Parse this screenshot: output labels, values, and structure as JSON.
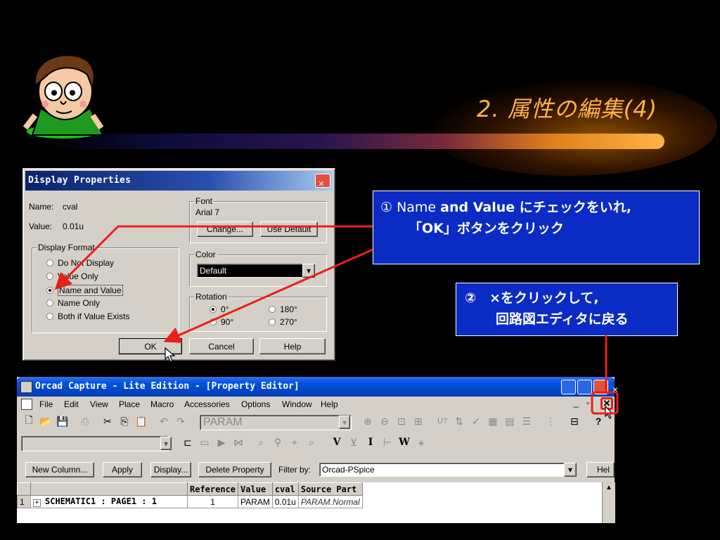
{
  "slide": {
    "title": "2. 属性の編集(4)"
  },
  "callouts": {
    "step1_line1_prefix": "① Name ",
    "step1_line1_bold": "and Value",
    "step1_line1_suffix": " にチェックをいれ,",
    "step1_line2": "「OK」ボタンをクリック",
    "step2_line1": "②　×をクリックして,",
    "step2_line2": "回路図エディタに戻る"
  },
  "dialog": {
    "title": "Display Properties",
    "name_label": "Name:",
    "name_value": "cval",
    "value_label": "Value:",
    "value_value": "0.01u",
    "format_legend": "Display Format",
    "format_options": [
      "Do Not Display",
      "Value Only",
      "Name and Value",
      "Name Only",
      "Both if Value Exists"
    ],
    "format_selected": "Name and Value",
    "font_legend": "Font",
    "font_value": "Arial 7",
    "change_button": "Change...",
    "use_default_button": "Use Default",
    "color_legend": "Color",
    "color_value": "Default",
    "rotation_legend": "Rotation",
    "rotation_options": [
      "0°",
      "90°",
      "180°",
      "270°"
    ],
    "rotation_selected": "0°",
    "ok_button": "OK",
    "cancel_button": "Cancel",
    "help_button": "Help"
  },
  "orcad": {
    "title": "Orcad Capture - Lite Edition - [Property Editor]",
    "menus": [
      "File",
      "Edit",
      "View",
      "Place",
      "Macro",
      "Accessories",
      "Options",
      "Window",
      "Help"
    ],
    "part_combo": "PARAM",
    "toolbar2_combo": "",
    "buttons": {
      "new_column": "New Column...",
      "apply": "Apply",
      "display": "Display...",
      "delete_property": "Delete Property",
      "filter_label": "Filter by:",
      "filter_value": "Orcad-PSpice",
      "help": "Hel"
    },
    "grid": {
      "headers": [
        "Reference",
        "Value",
        "cval",
        "Source Part"
      ],
      "rows": [
        {
          "num": "1",
          "expander": "+",
          "name": "SCHEMATIC1 : PAGE1 : 1",
          "reference": "1",
          "value": "PARAM",
          "cval": "0.01u",
          "source_part": "PARAM.Normal"
        }
      ]
    }
  }
}
